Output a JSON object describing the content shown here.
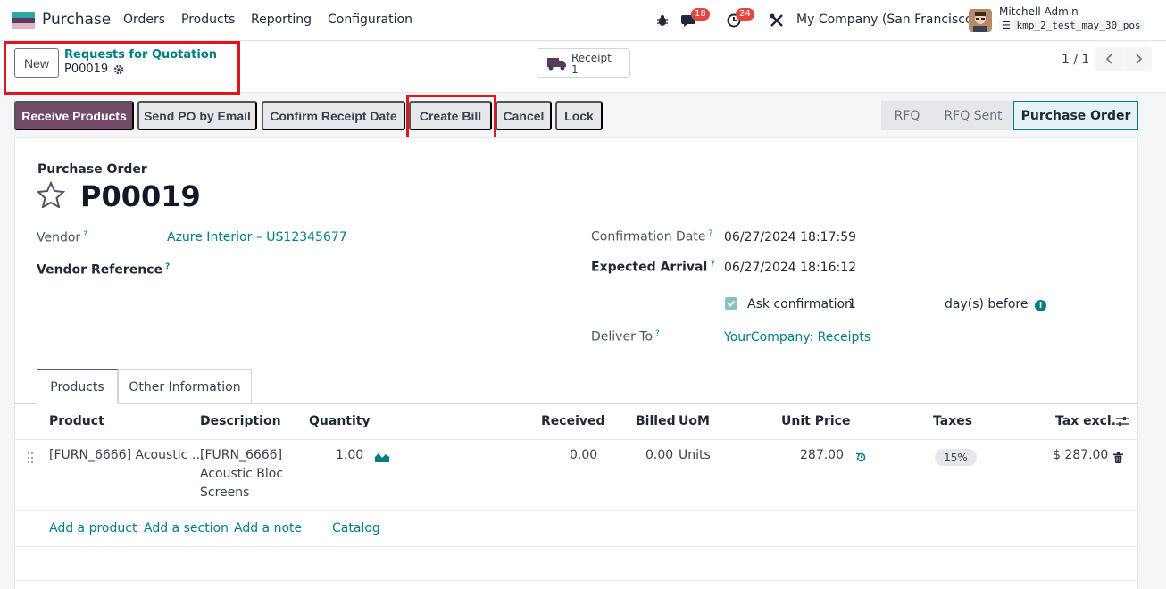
{
  "navbar": {
    "app_name": "Purchase",
    "menu": [
      "Orders",
      "Products",
      "Reporting",
      "Configuration"
    ],
    "chat_badge": "18",
    "activity_badge": "24",
    "company": "My Company (San Francisco)",
    "user_name": "Mitchell Admin",
    "db_name": "kmp_2_test_may_30_pos"
  },
  "control": {
    "new_label": "New",
    "breadcrumb_parent": "Requests for Quotation",
    "breadcrumb_current": "P00019",
    "receipt_label": "Receipt",
    "receipt_count": "1",
    "pager": "1 / 1"
  },
  "actions": {
    "receive": "Receive Products",
    "send_email": "Send PO by Email",
    "confirm_receipt": "Confirm Receipt Date",
    "create_bill": "Create Bill",
    "cancel": "Cancel",
    "lock": "Lock"
  },
  "status": {
    "steps": [
      "RFQ",
      "RFQ Sent",
      "Purchase Order"
    ],
    "active": "Purchase Order"
  },
  "form": {
    "kind": "Purchase Order",
    "name": "P00019",
    "vendor_label": "Vendor",
    "vendor_value": "Azure Interior – US12345677",
    "vendor_ref_label": "Vendor Reference",
    "confirmation_label": "Confirmation Date",
    "confirmation_value": "06/27/2024 18:17:59",
    "expected_label": "Expected Arrival",
    "expected_value": "06/27/2024 18:16:12",
    "ask_confirm_label": "Ask confirmation",
    "ask_confirm_days": "1",
    "days_before": "day(s) before",
    "deliver_label": "Deliver To",
    "deliver_value": "YourCompany: Receipts",
    "help_mark": "?"
  },
  "tabs": [
    "Products",
    "Other Information"
  ],
  "table": {
    "headers": {
      "product": "Product",
      "description": "Description",
      "quantity": "Quantity",
      "received": "Received",
      "billed": "Billed",
      "uom": "UoM",
      "unit_price": "Unit Price",
      "taxes": "Taxes",
      "tax_excl": "Tax excl."
    },
    "row": {
      "product": "[FURN_6666] Acoustic …",
      "desc_1": "[FURN_6666]",
      "desc_2": "Acoustic Bloc",
      "desc_3": "Screens",
      "quantity": "1.00",
      "received": "0.00",
      "billed": "0.00",
      "uom": "Units",
      "unit_price": "287.00",
      "tax": "15%",
      "subtotal": "$ 287.00"
    },
    "add_product": "Add a product",
    "add_section": "Add a section",
    "add_note": "Add a note",
    "catalog": "Catalog"
  }
}
